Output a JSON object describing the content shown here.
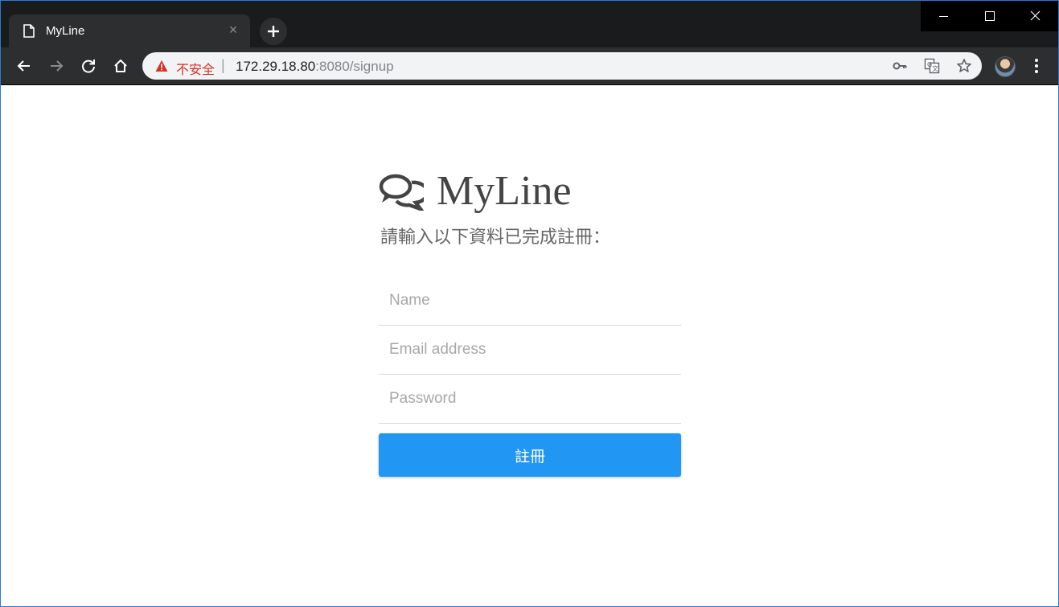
{
  "browser": {
    "tab_title": "MyLine",
    "tab_close_label": "×",
    "security_text": "不安全",
    "separator": "|",
    "url_host": "172.29.18.80",
    "url_rest": ":8080/signup",
    "icons": {
      "tab_page": "page-icon",
      "new_tab": "plus-icon",
      "back": "back-arrow-icon",
      "forward": "forward-arrow-icon",
      "reload": "reload-icon",
      "home": "home-icon",
      "warning": "warning-triangle-icon",
      "key": "key-icon",
      "translate": "translate-icon",
      "bookmark": "star-icon",
      "profile": "avatar",
      "menu": "kebab-menu-icon",
      "minimize": "minimize-icon",
      "maximize": "maximize-icon",
      "close": "close-icon"
    }
  },
  "page": {
    "brand_name": "MyLine",
    "brand_icon": "chat-bubbles-icon",
    "subtitle": "請輸入以下資料已完成註冊：",
    "form": {
      "name_placeholder": "Name",
      "email_placeholder": "Email address",
      "password_placeholder": "Password",
      "submit_label": "註冊"
    }
  },
  "colors": {
    "tabstrip_bg": "#1a1b1d",
    "toolbar_bg": "#2d2e30",
    "security_warning": "#d93025",
    "primary_button": "#2196f3",
    "brand_text": "#444444"
  }
}
